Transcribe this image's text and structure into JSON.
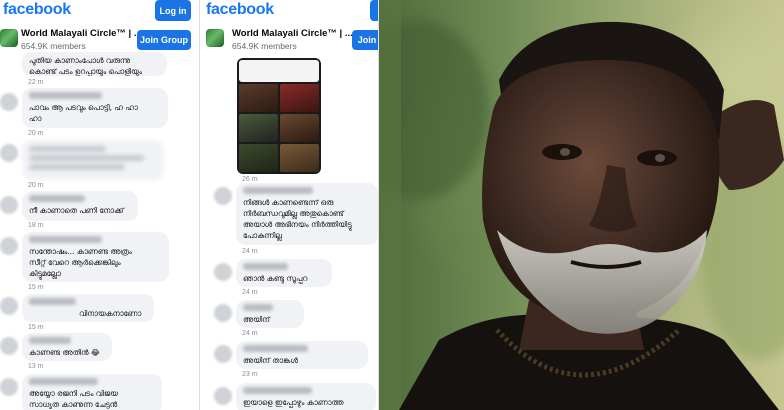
{
  "left_panel": {
    "brand": "facebook",
    "login_label": "Log in",
    "group_name": "World Malayali Circle™ | ...",
    "members": "654.9K members",
    "join_label": "Join Group",
    "comments": [
      {
        "lines": [
          "പുതിയ കാണാംപോൾ വരുന്നു",
          "കൊണ്ട് പടം ഉറപ്പായും പൊളിയും"
        ],
        "time": "22 m"
      },
      {
        "lines": [
          "പാവം ആ പടവും പൊട്ടി, ഹ ഹാ",
          "ഹാ"
        ],
        "time": "20 m"
      },
      {
        "lines": [],
        "time": "20 m"
      },
      {
        "lines": [
          "നീ കാണാതെ പണി നോക്ക്"
        ],
        "time": "18 m"
      },
      {
        "lines": [
          "സന്തോഷം... കാണണ്ട അത്രം",
          "സീറ്റ് വേറെ ആർക്കെങ്കിലും",
          "കിട്ടുമല്ലോ"
        ],
        "time": "15 m"
      },
      {
        "lines": [
          "വിനായകനാണോ"
        ],
        "time": "15 m"
      },
      {
        "lines": [
          "കാണണ്ട അതിൻ 😂"
        ],
        "time": "13 m"
      },
      {
        "lines": [
          "അയ്യോ രജനി പടം വിജയ",
          "സാധ്യത കാണുന്ന ചേട്ടൻ"
        ],
        "time": ""
      }
    ]
  },
  "mid_panel": {
    "brand": "facebook",
    "group_name": "World Malayali Circle™ | ...",
    "members": "654.9K members",
    "join_label": "Join",
    "image_time": "26 m",
    "comments": [
      {
        "lines": [
          "നിങ്ങൾ കാണണ്ടെന്ന് ഒരു",
          "നിർബന്ധവുമില്ല അതുകൊണ്ട്",
          "അയാൾ അഭിനയം നിർത്തിയിട്ടു",
          "പോകുന്നില്ല"
        ],
        "time": "24 m"
      },
      {
        "lines": [
          "ഞാൻ കണ്ടു സൂപ്പറ"
        ],
        "time": "24 m"
      },
      {
        "lines": [
          "അയിന്"
        ],
        "time": "24 m"
      },
      {
        "lines": [
          "അയിന് താങ്കൾ"
        ],
        "time": "23 m"
      },
      {
        "lines": [
          "ഇയാളെ ഇപ്പോഴും കാണാത്ത"
        ],
        "time": ""
      }
    ]
  },
  "photo": {
    "description_icon": "portrait-photo"
  }
}
